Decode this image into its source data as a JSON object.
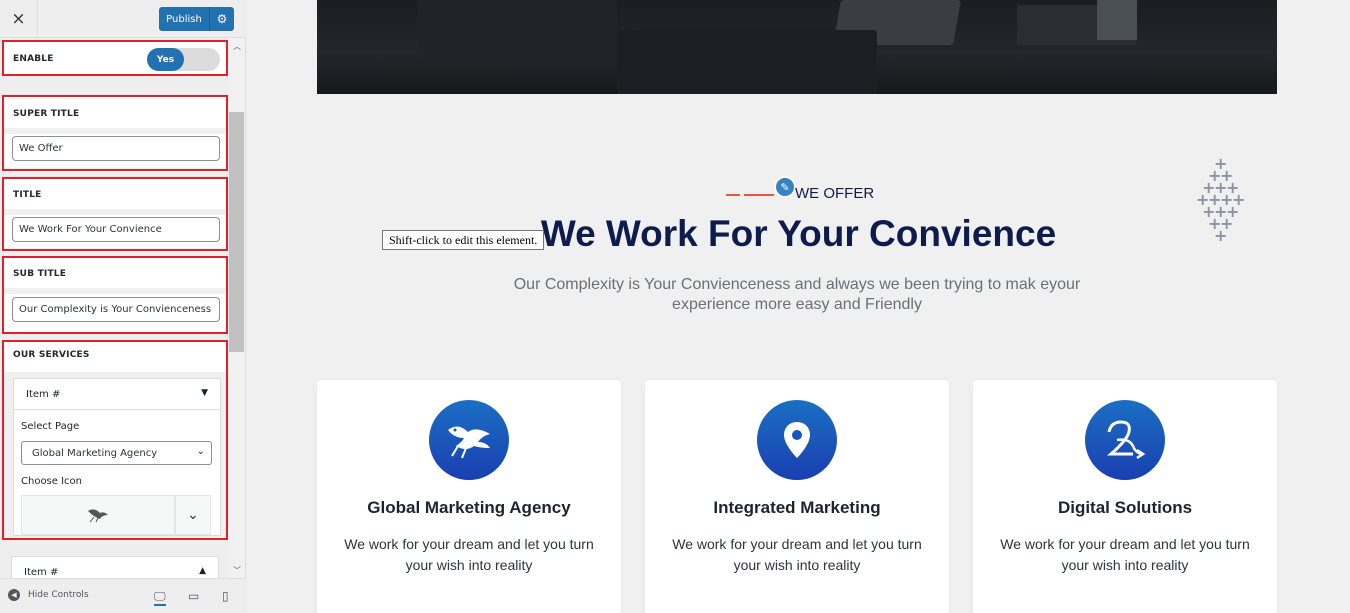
{
  "topbar": {
    "close_icon": "×",
    "publish_label": "Publish",
    "settings_icon": "gear-icon"
  },
  "controls": {
    "enable": {
      "label": "ENABLE",
      "toggle_value": "Yes"
    },
    "super_title": {
      "label": "SUPER TITLE",
      "value": "We Offer"
    },
    "title": {
      "label": "TITLE",
      "value": "We Work For Your Convience"
    },
    "sub_title": {
      "label": "SUB TITLE",
      "value": "Our Complexity is Your Convienceness"
    },
    "our_services": {
      "label": "OUR SERVICES",
      "items": [
        {
          "header": "Item #",
          "expanded": true,
          "select_page_label": "Select Page",
          "select_page_value": "Global Marketing Agency",
          "choose_icon_label": "Choose Icon"
        },
        {
          "header": "Item #",
          "expanded": false
        }
      ]
    }
  },
  "bottombar": {
    "hide_controls_label": "Hide Controls"
  },
  "preview": {
    "super_title": "WE OFFER",
    "title": "We Work For Your Convience",
    "tooltip": "Shift-click to edit this element.",
    "sub_title": "Our Complexity is Your Convienceness and always we been trying to mak eyour experience more easy and Friendly",
    "cards": [
      {
        "title": "Global Marketing Agency",
        "desc": "We work for your dream and let you turn your wish into reality",
        "icon": "bird-icon"
      },
      {
        "title": "Integrated Marketing",
        "desc": "We work for your dream and let you turn your wish into reality",
        "icon": "location-pin-icon"
      },
      {
        "title": "Digital Solutions",
        "desc": "We work for your dream and let you turn your wish into reality",
        "icon": "number-2-arrow-icon"
      }
    ]
  },
  "colors": {
    "accent_blue": "#2271b1",
    "highlight_red": "#e0202a",
    "title_navy": "#0e1c4d",
    "dash_orange": "#e8573c"
  }
}
